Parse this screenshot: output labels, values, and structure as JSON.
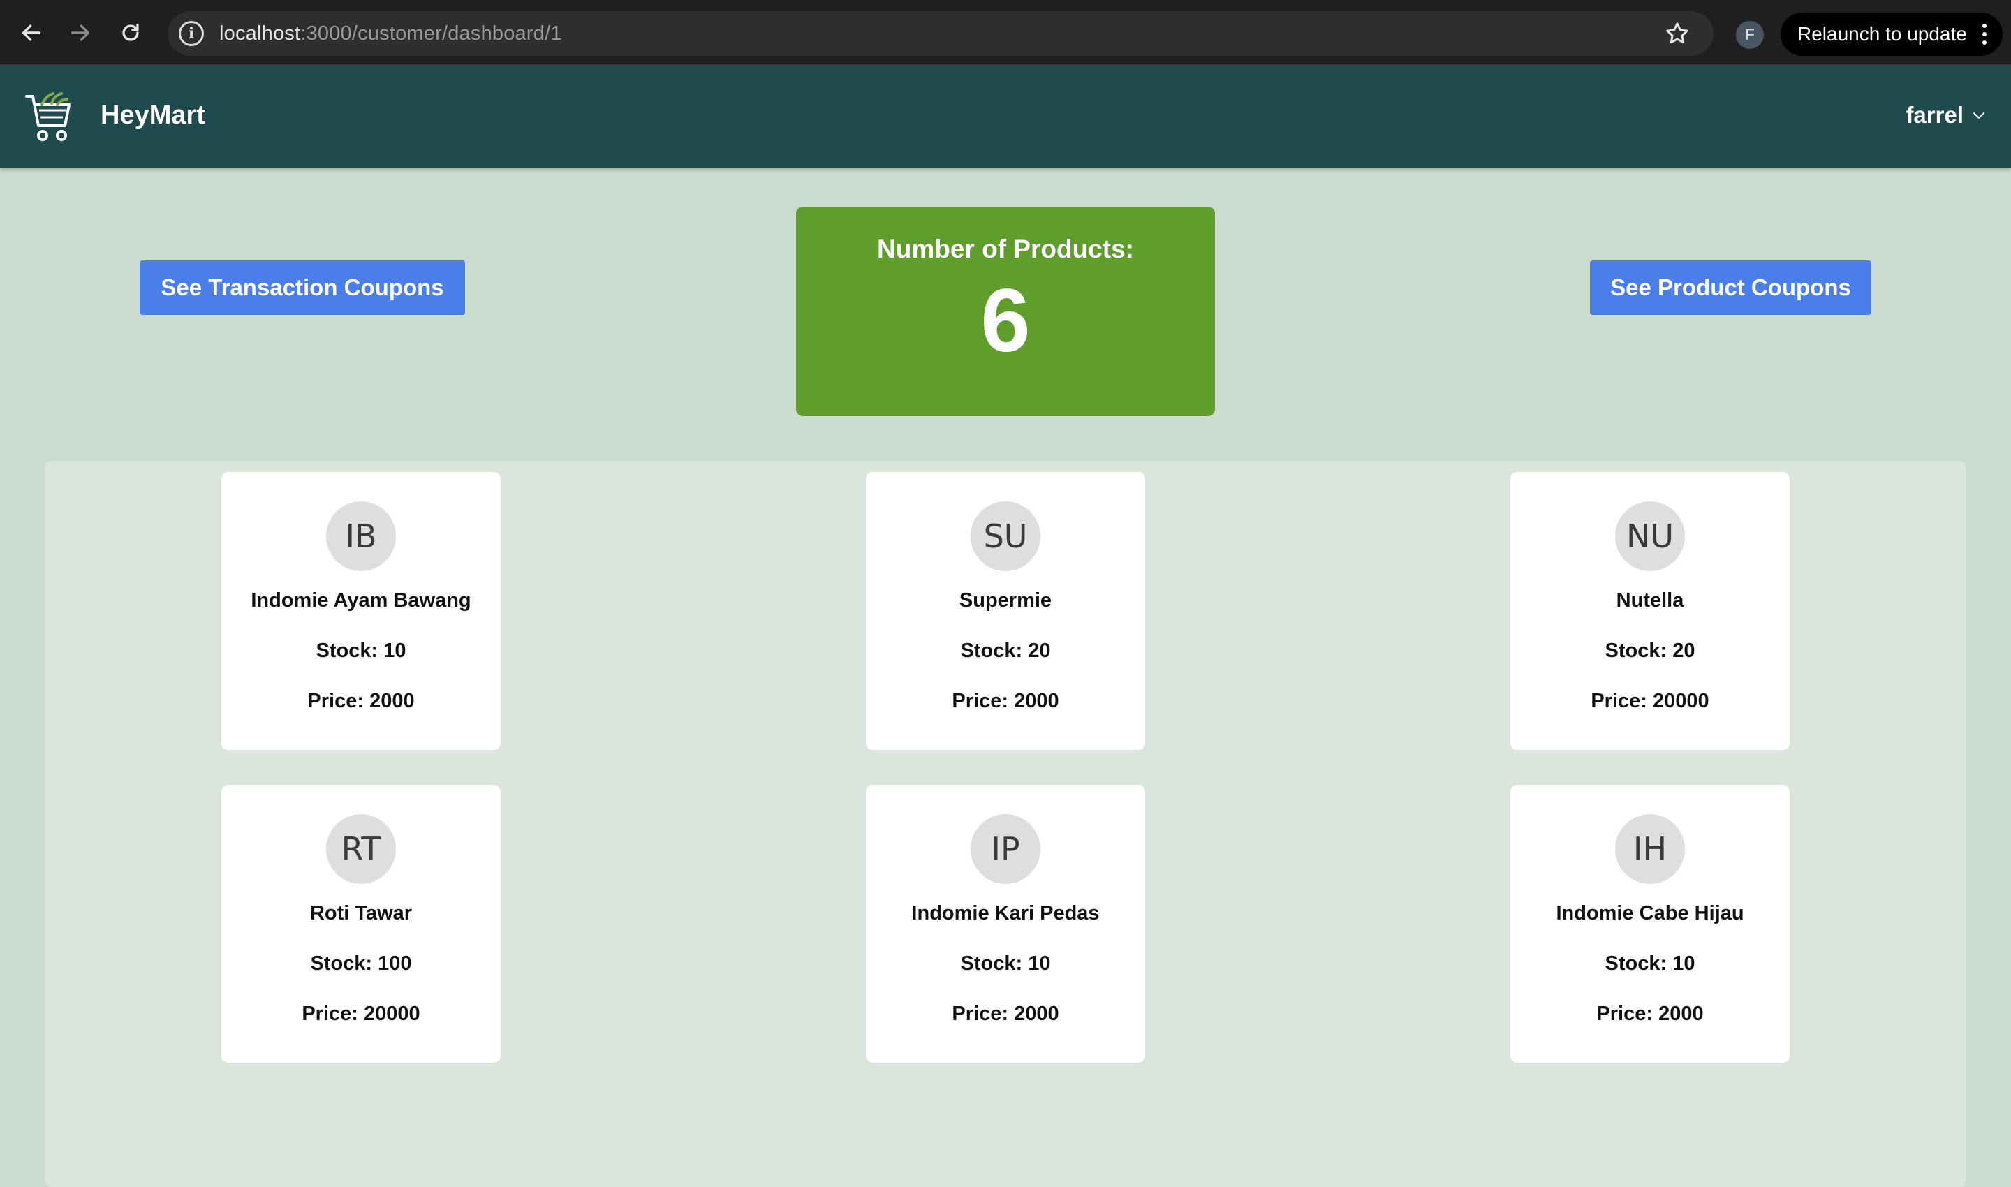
{
  "browser": {
    "url_host": "localhost",
    "url_path": ":3000/customer/dashboard/1",
    "profile_initial": "F",
    "relaunch_label": "Relaunch to update"
  },
  "header": {
    "brand": "HeyMart",
    "username": "farrel"
  },
  "actions": {
    "transaction_coupons": "See Transaction Coupons",
    "product_coupons": "See Product Coupons"
  },
  "summary": {
    "title": "Number of Products:",
    "count": "6"
  },
  "colors": {
    "header_bg": "#1f4a4e",
    "page_bg": "#c9dccf",
    "accent_blue": "#4a7fea",
    "count_green": "#609e2b"
  },
  "products": [
    {
      "initials": "IB",
      "name": "Indomie Ayam Bawang",
      "stock": "Stock: 10",
      "price": "Price: 2000"
    },
    {
      "initials": "SU",
      "name": "Supermie",
      "stock": "Stock: 20",
      "price": "Price: 2000"
    },
    {
      "initials": "NU",
      "name": "Nutella",
      "stock": "Stock: 20",
      "price": "Price: 20000"
    },
    {
      "initials": "RT",
      "name": "Roti Tawar",
      "stock": "Stock: 100",
      "price": "Price: 20000"
    },
    {
      "initials": "IP",
      "name": "Indomie Kari Pedas",
      "stock": "Stock: 10",
      "price": "Price: 2000"
    },
    {
      "initials": "IH",
      "name": "Indomie Cabe Hijau",
      "stock": "Stock: 10",
      "price": "Price: 2000"
    }
  ]
}
